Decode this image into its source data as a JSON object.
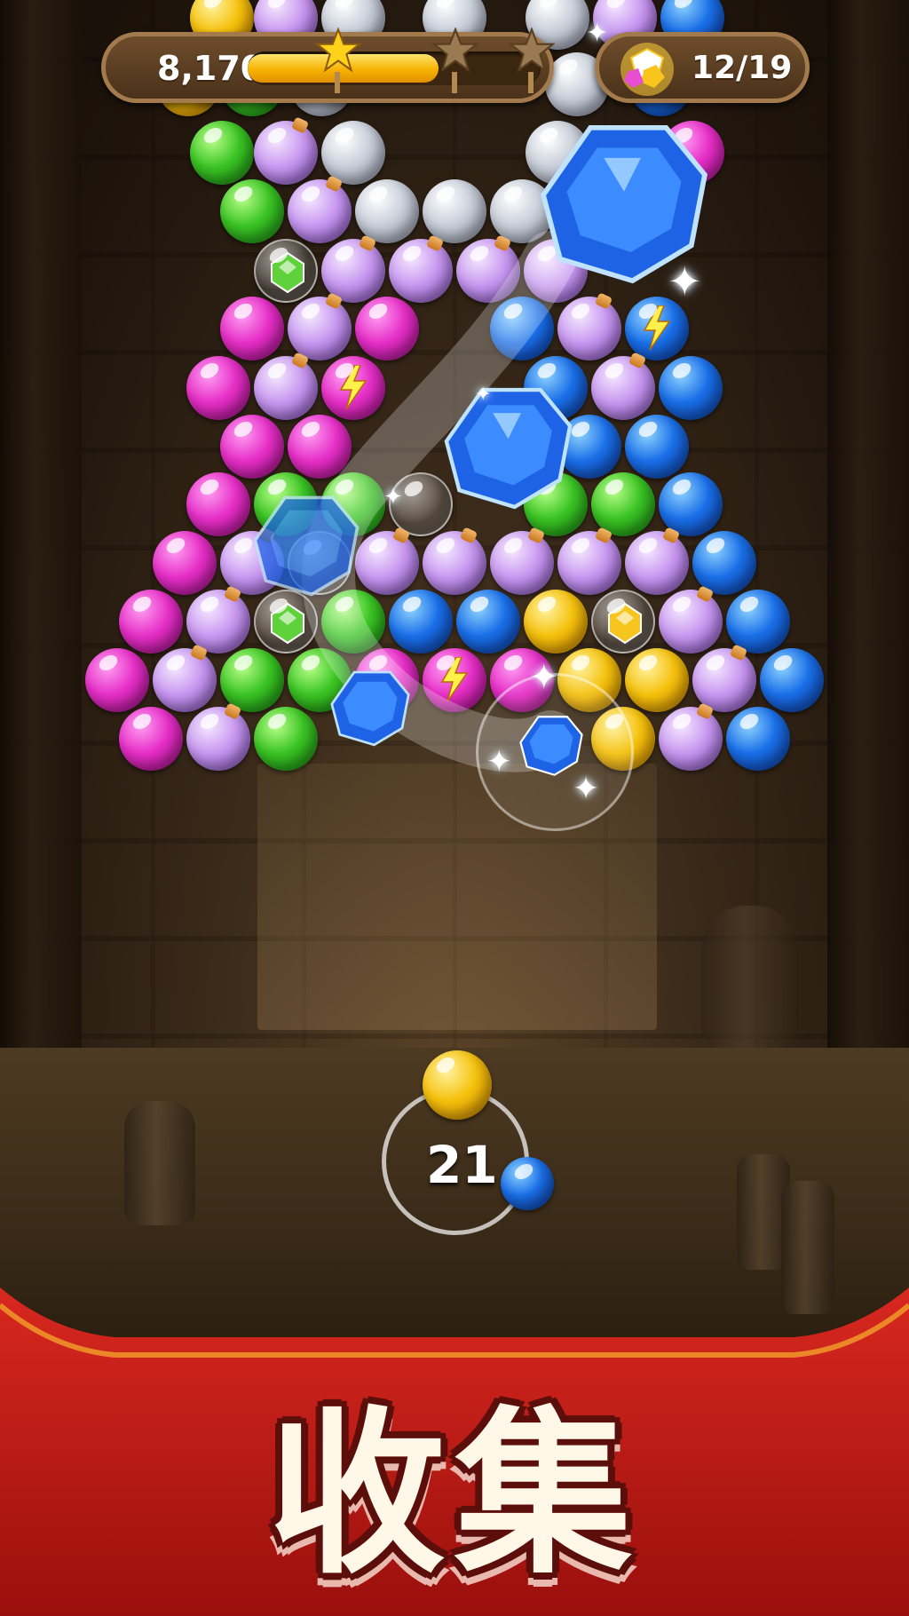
{
  "hud": {
    "score": "8,170",
    "score_progress": 0.65,
    "stars_earned": 1,
    "stars_total": 3,
    "gem_goal": "12/19"
  },
  "shooter": {
    "moves_left": "21",
    "current_ball_color": "yellow",
    "next_ball_color": "blue"
  },
  "banner": {
    "title": "收集"
  },
  "board": {
    "colors": {
      "magenta": "#e62fc7",
      "green": "#3bc424",
      "blue": "#1a6fe8",
      "yellow": "#f5c10d",
      "silver": "#c7cdd8",
      "potion": "#c898f0",
      "gem_blue": "#1e63e6",
      "gem_green": "#5fd13a",
      "gem_yellow": "#f7c51d",
      "bolt": "#fff04a"
    },
    "special_items": [
      "potion-bubble",
      "lightning-bubble",
      "gem-bubble"
    ]
  }
}
